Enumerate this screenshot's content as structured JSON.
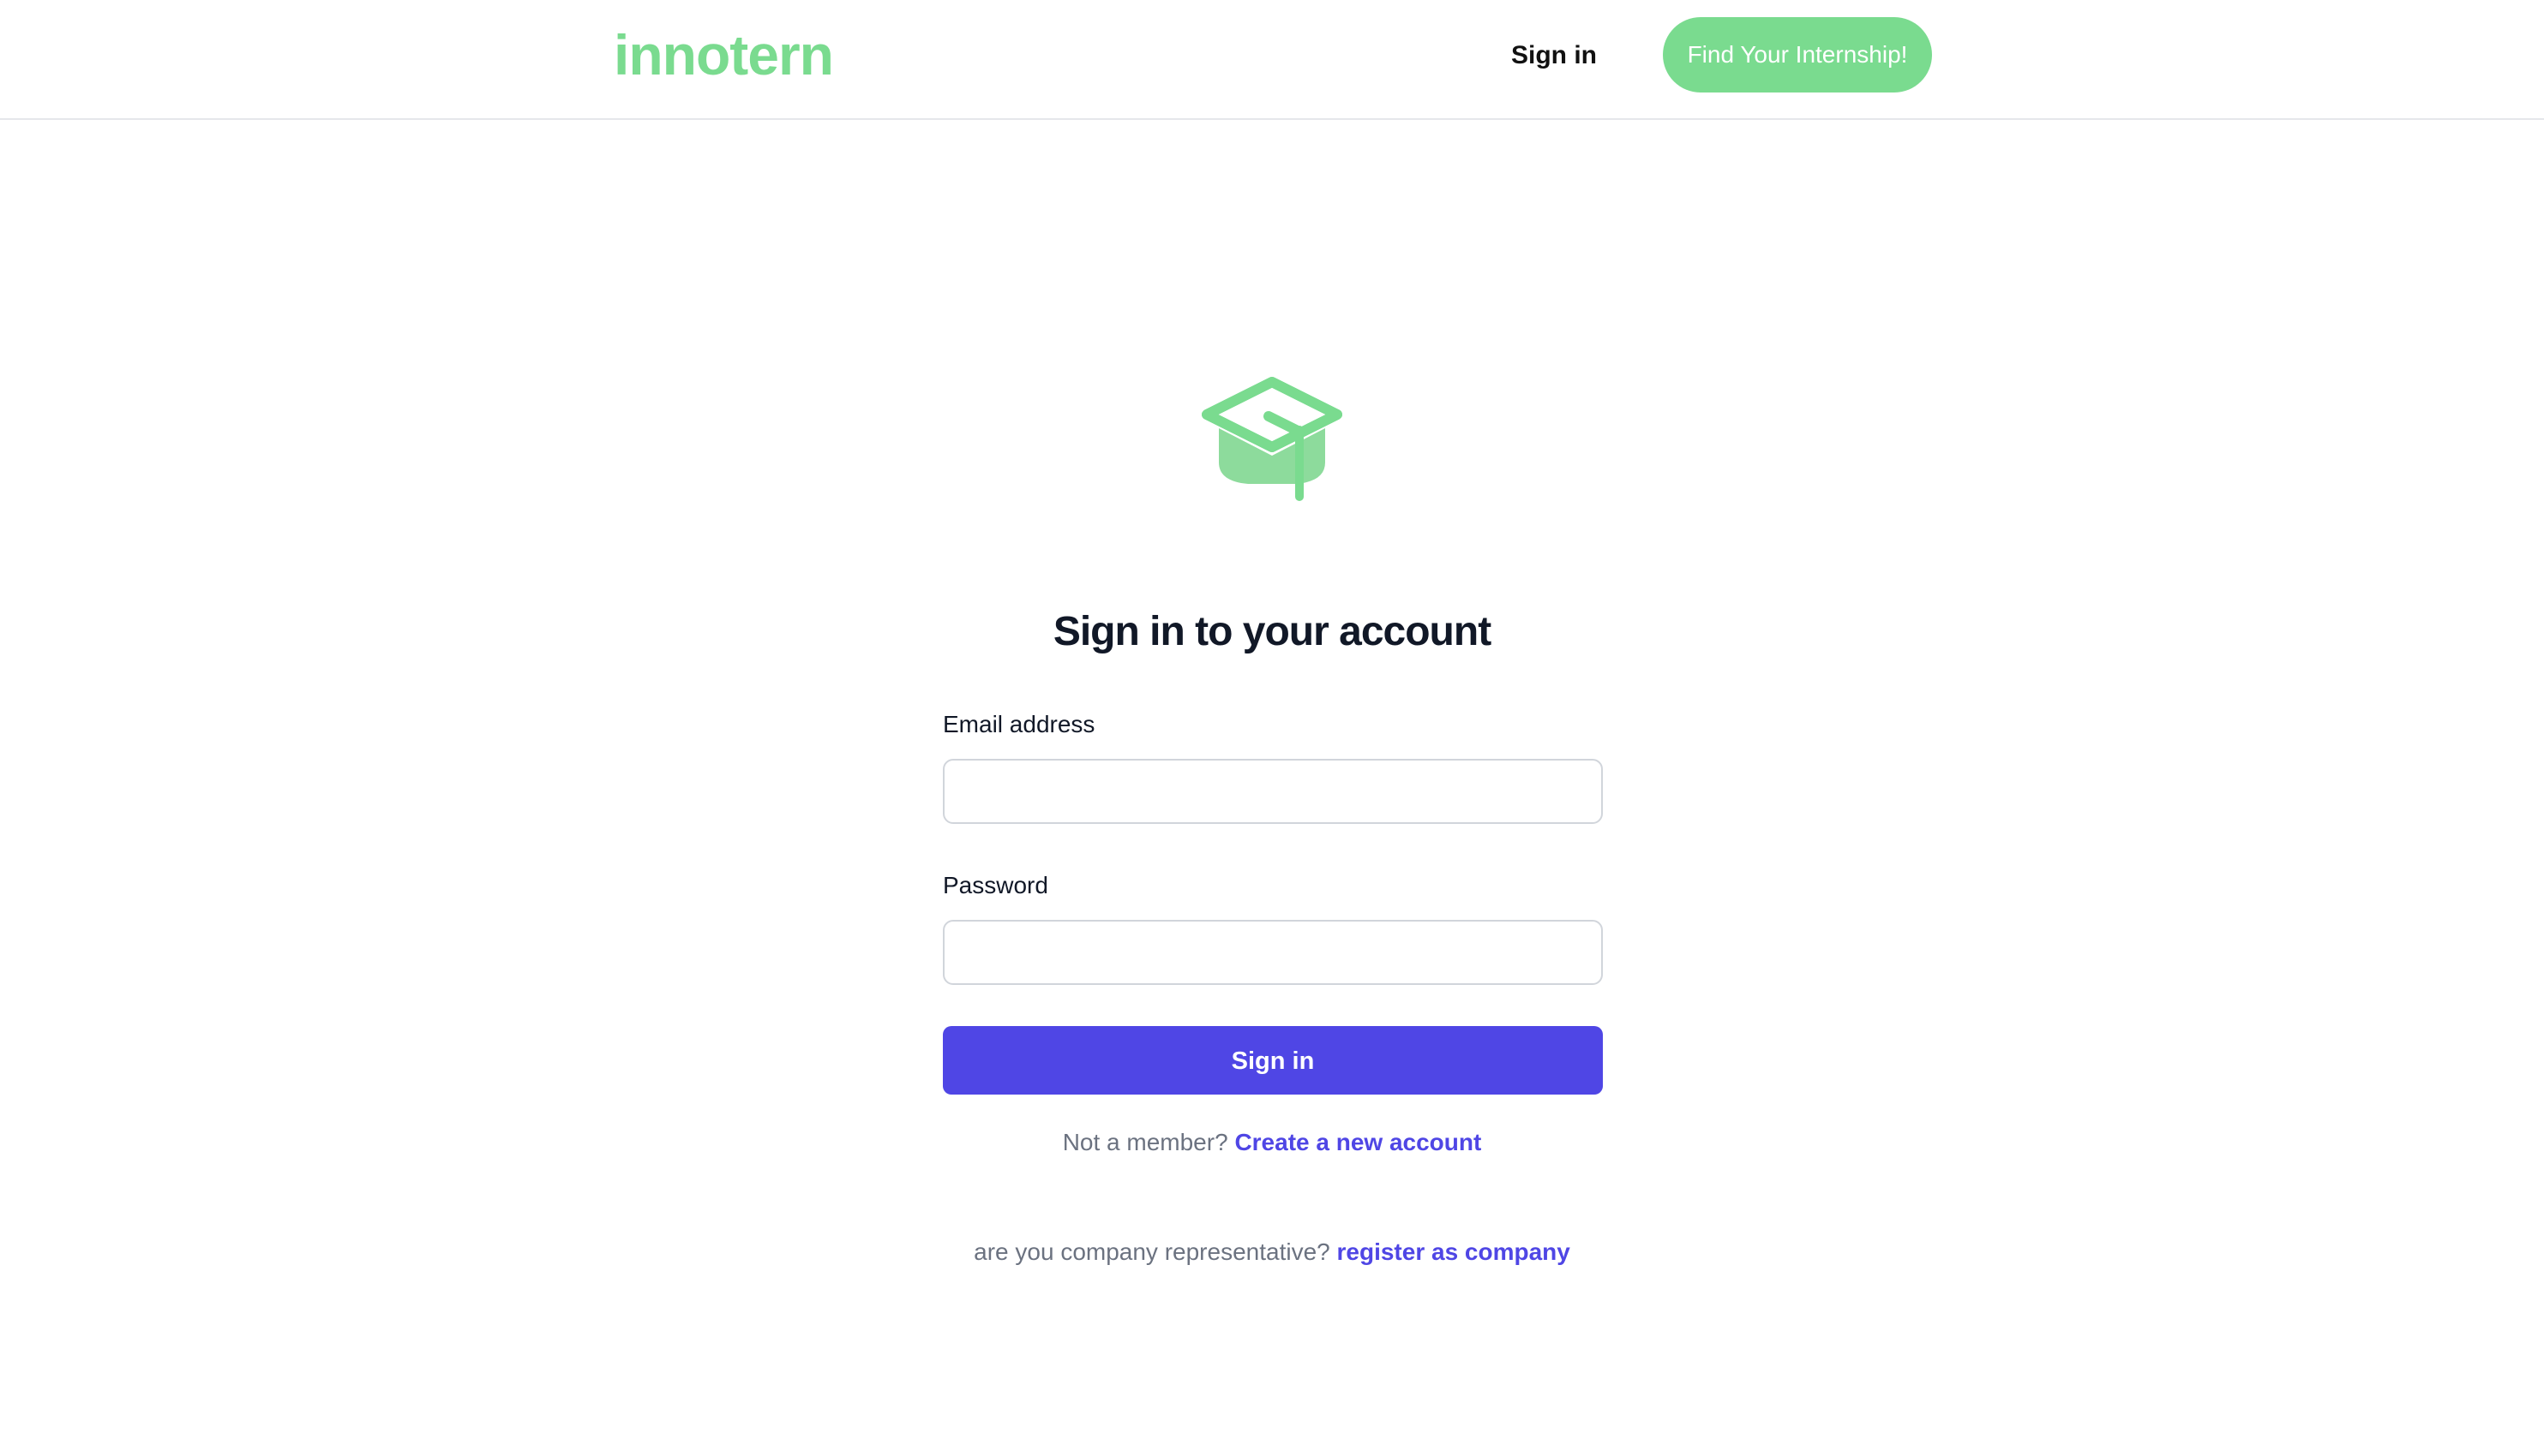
{
  "header": {
    "logo": "innotern",
    "signin_label": "Sign in",
    "cta_label": "Find Your Internship!"
  },
  "hero": {
    "icon": "graduation-cap-icon",
    "title": "Sign in to your account"
  },
  "form": {
    "email_label": "Email address",
    "email_value": "",
    "password_label": "Password",
    "password_value": "",
    "submit_label": "Sign in"
  },
  "footer_links": {
    "member_prompt": "Not a member?",
    "member_link": "Create a new account",
    "company_prompt": "are you company representative?",
    "company_link": "register as company"
  },
  "colors": {
    "brand_green": "#7adb8f",
    "primary_indigo": "#4f46e5",
    "muted_text": "#6b7280"
  }
}
